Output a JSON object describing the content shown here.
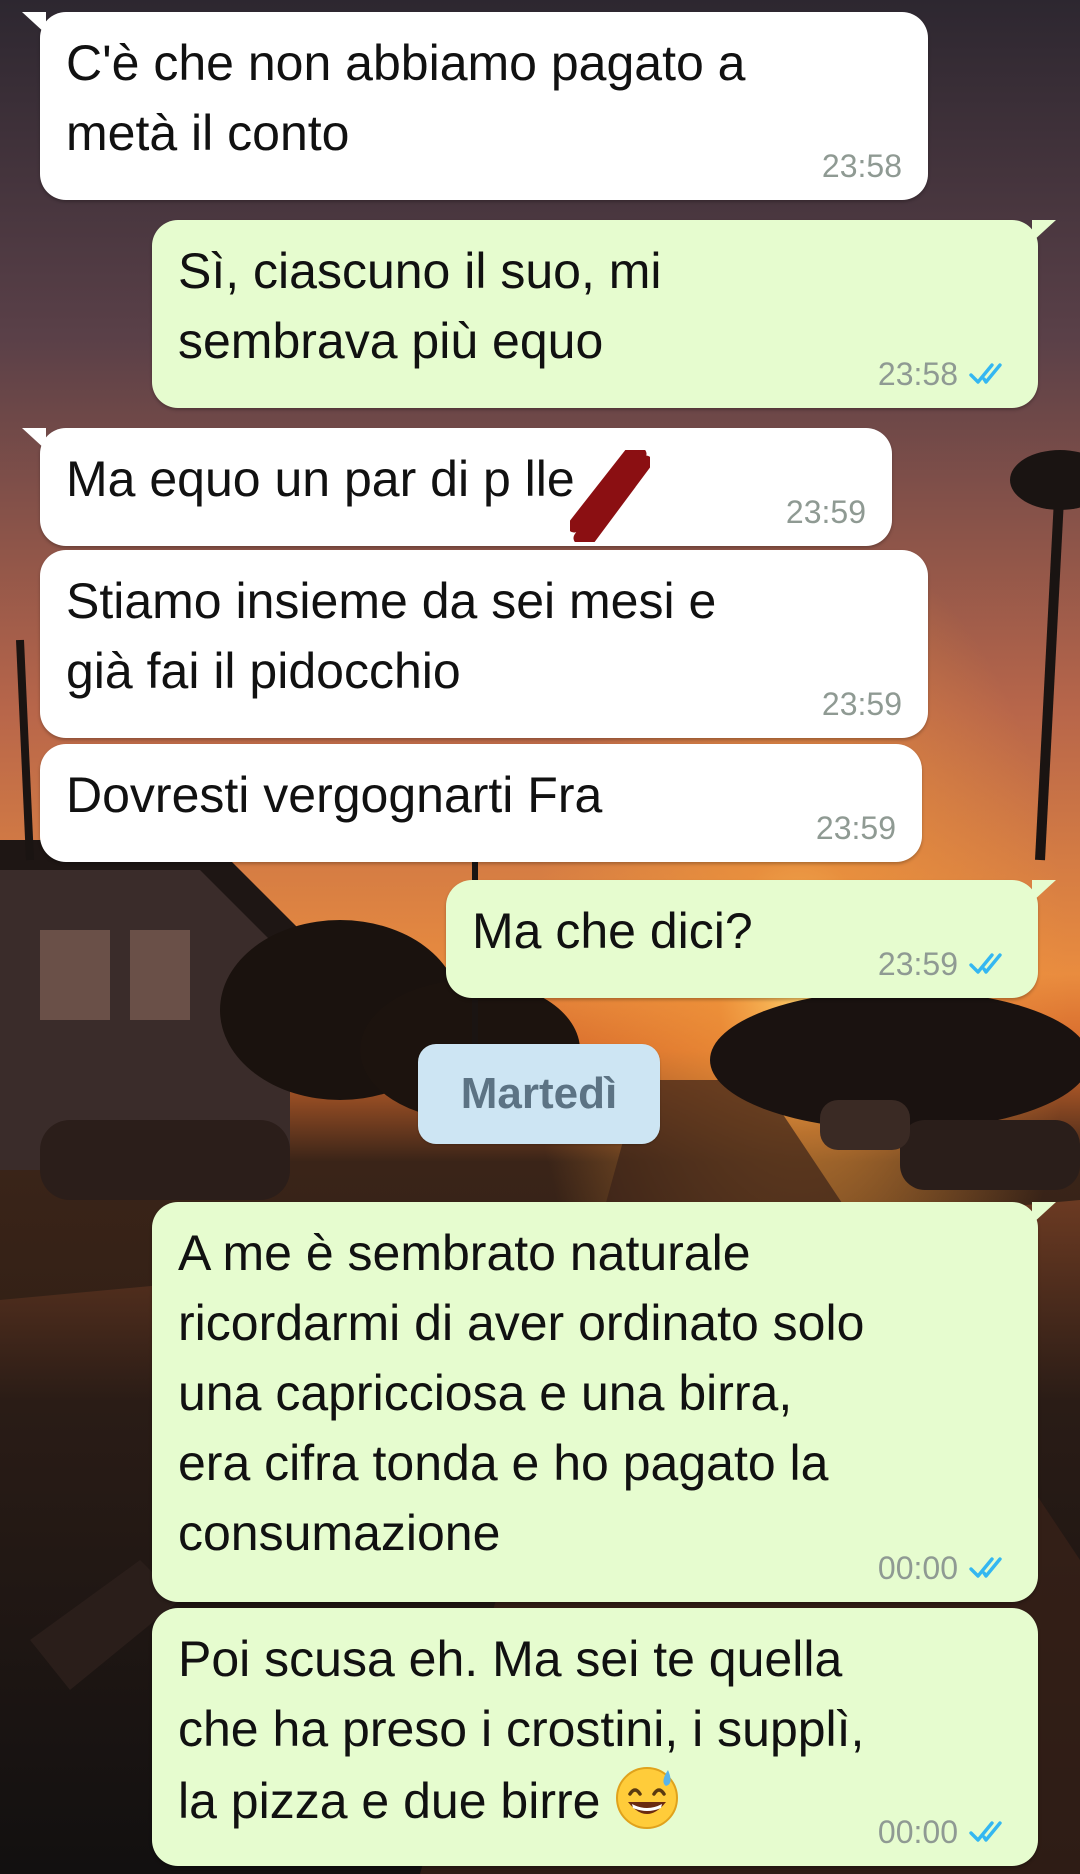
{
  "messages": [
    {
      "side": "in",
      "text": "C'è che non abbiamo pagato a\nmetà il conto",
      "time": "23:58"
    },
    {
      "side": "out",
      "text": "Sì, ciascuno il suo, mi\nsembrava più equo",
      "time": "23:58",
      "status": "read"
    },
    {
      "side": "in",
      "text": "Ma equo un par di p  lle",
      "time": "23:59"
    },
    {
      "side": "in",
      "text": "Stiamo insieme da sei mesi e\ngià fai il pidocchio",
      "time": "23:59"
    },
    {
      "side": "in",
      "text": "Dovresti vergognarti Fra",
      "time": "23:59"
    },
    {
      "side": "out",
      "text": "Ma che dici?",
      "time": "23:59",
      "status": "read"
    },
    {
      "side": "out",
      "text": "A me è sembrato naturale\nricordarmi di aver ordinato solo\nuna capricciosa e una birra,\nera cifra tonda e ho pagato la\nconsumazione",
      "time": "00:00",
      "status": "read"
    },
    {
      "side": "out",
      "text": "Poi scusa eh. Ma sei te quella\nche ha preso i crostini, i supplì,\nla pizza e due birre",
      "time": "00:00",
      "status": "read",
      "emoji": "grinning-sweat-emoji"
    }
  ],
  "date_separator": "Martedì",
  "colors": {
    "incoming_bubble": "#ffffff",
    "outgoing_bubble": "#e6fccf",
    "timestamp": "#8f9a93",
    "read_tick": "#34b7f1",
    "date_chip": "#cde5f3",
    "date_chip_text": "#5c7384",
    "redaction_scribble": "#8b0f12"
  },
  "icons": {
    "read_receipt": "double-check-icon",
    "redaction": "red-scribble"
  }
}
